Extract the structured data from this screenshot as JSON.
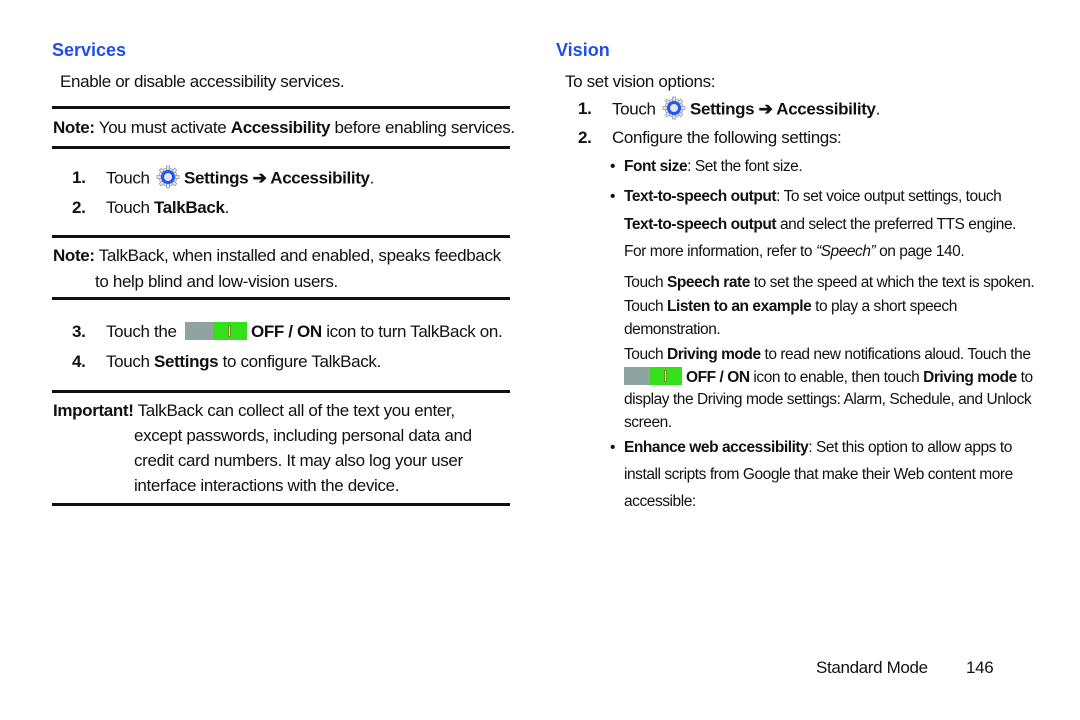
{
  "left": {
    "heading": "Services",
    "intro": "Enable or disable accessibility services.",
    "note1": {
      "label": "Note:",
      "text_pre": " You must activate ",
      "bold": "Accessibility",
      "text_post": " before enabling services."
    },
    "steps_a": [
      {
        "num": "1.",
        "pre": "Touch",
        "icon": "settings-gear-icon",
        "bold": "Settings ➔ Accessibility",
        "post": "."
      },
      {
        "num": "2.",
        "pre": "Touch ",
        "bold": "TalkBack",
        "post": "."
      }
    ],
    "note2": {
      "label": "Note:",
      "line1": " TalkBack, when installed and enabled, speaks feedback",
      "line2": "to help blind and low-vision users."
    },
    "steps_b": [
      {
        "num": "3.",
        "pre": "Touch the",
        "icon": "off-on-toggle-icon",
        "bold": "OFF / ON",
        "post": " icon to turn TalkBack on."
      },
      {
        "num": "4.",
        "pre": "Touch ",
        "bold": "Settings",
        "post": " to configure TalkBack."
      }
    ],
    "important": {
      "label": "Important!",
      "lines": [
        " TalkBack can collect all of the text you enter,",
        "except passwords, including personal data and",
        "credit card numbers. It may also log your user",
        "interface interactions with the device."
      ]
    }
  },
  "right": {
    "heading": "Vision",
    "intro": "To set vision options:",
    "steps": [
      {
        "num": "1.",
        "pre": "Touch",
        "icon": "settings-gear-icon",
        "bold": "Settings ➔ Accessibility",
        "post": "."
      },
      {
        "num": "2.",
        "text": "Configure the following settings:"
      }
    ],
    "bullets": {
      "font_size": {
        "bold": "Font size",
        "text": ": Set the font size."
      },
      "tts": {
        "bold": "Text-to-speech output",
        "line1_post": ": To set voice output settings, touch",
        "line2_bold": "Text-to-speech output",
        "line2_post": " and select the preferred TTS engine.",
        "line3_pre": "For more information, refer to ",
        "line3_link": "“Speech”",
        "line3_post": " on page 140."
      },
      "speech_rate": {
        "pre": "Touch ",
        "bold": "Speech rate",
        "post": " to set the speed at which the text is spoken."
      },
      "listen": {
        "pre": "Touch ",
        "bold": "Listen to an example",
        "post": " to play a short speech",
        "line2": "demonstration."
      },
      "driving": {
        "pre": "Touch ",
        "bold": "Driving mode",
        "post": " to read new notifications aloud. Touch the",
        "line2_bold": "OFF / ON",
        "line2_mid": " icon to enable, then touch ",
        "line2_bold2": "Driving mode",
        "line2_post": " to",
        "line3": "display the Driving mode settings: Alarm, Schedule, and Unlock",
        "line4": "screen."
      },
      "web": {
        "bold": "Enhance web accessibility",
        "line1_post": ": Set this option to allow apps to",
        "line2": "install scripts from Google that make their Web content more",
        "line3": "accessible:"
      }
    }
  },
  "footer": {
    "mode": "Standard Mode",
    "page": "146"
  },
  "colors": {
    "heading": "#1f4fe6",
    "toggle_on": "#33e01a",
    "toggle_off": "#8fa3a0"
  }
}
